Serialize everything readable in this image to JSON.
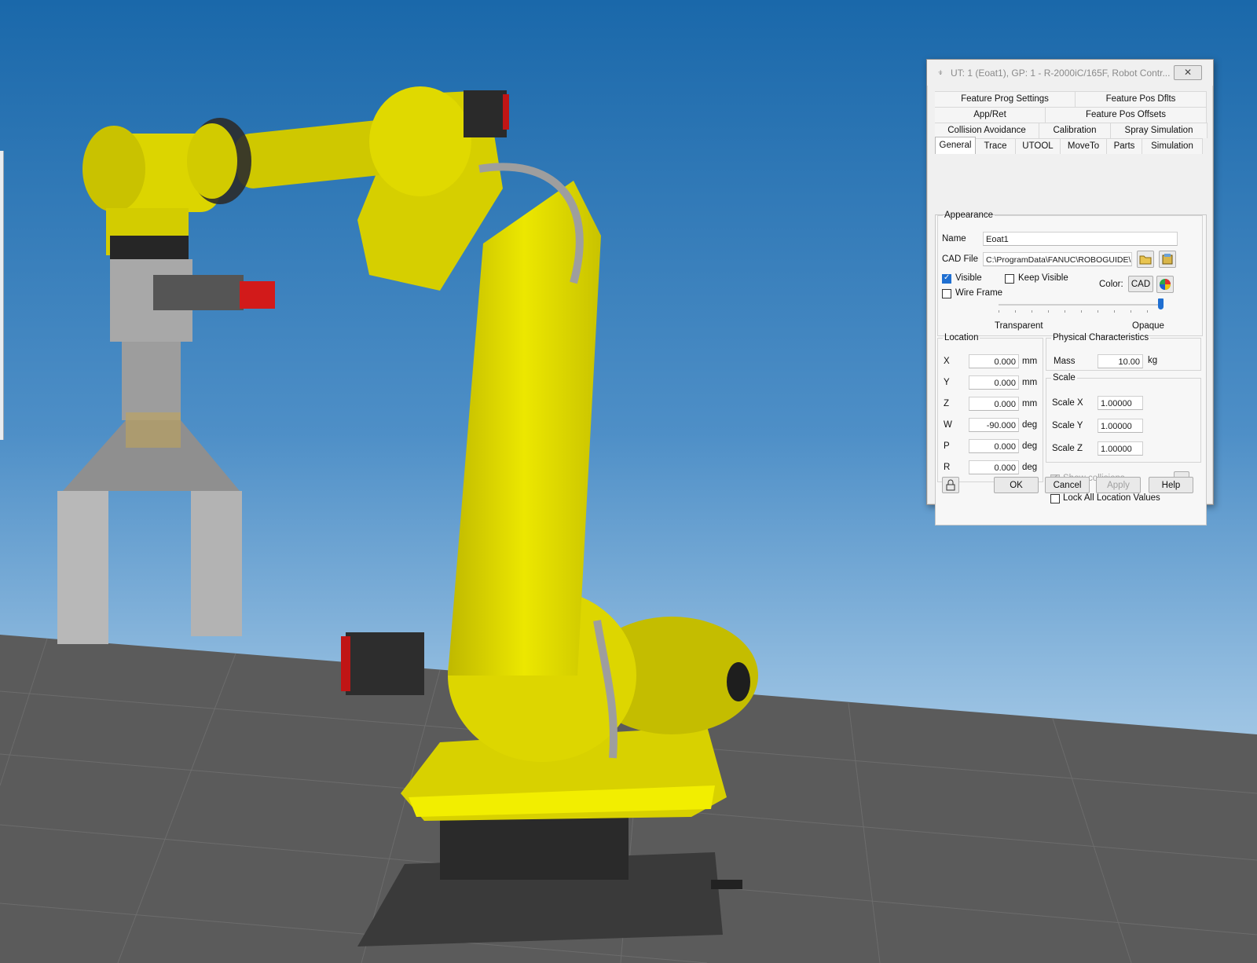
{
  "dialog": {
    "title": "UT: 1 (Eoat1), GP: 1 - R-2000iC/165F, Robot Contr...",
    "close_label": "✕",
    "tabs_row1": [
      "Feature Prog Settings",
      "Feature Pos Dflts"
    ],
    "tabs_row2": [
      "App/Ret",
      "Feature Pos Offsets"
    ],
    "tabs_row3": [
      "Collision Avoidance",
      "Calibration",
      "Spray Simulation"
    ],
    "tabs_row4": [
      "General",
      "Trace",
      "UTOOL",
      "MoveTo",
      "Parts",
      "Simulation"
    ],
    "active_tab": "General",
    "appearance": {
      "legend": "Appearance",
      "name_label": "Name",
      "name_value": "Eoat1",
      "cad_label": "CAD File",
      "cad_value": "C:\\ProgramData\\FANUC\\ROBOGUIDE\\",
      "visible_label": "Visible",
      "visible_checked": true,
      "keep_visible_label": "Keep Visible",
      "keep_visible_checked": false,
      "wire_frame_label": "Wire Frame",
      "wire_frame_checked": false,
      "color_label": "Color:",
      "cad_color_button": "CAD",
      "transparent_label": "Transparent",
      "opaque_label": "Opaque",
      "opacity_level": 1.0
    },
    "location": {
      "legend": "Location",
      "rows": [
        {
          "label": "X",
          "value": "0.000",
          "unit": "mm"
        },
        {
          "label": "Y",
          "value": "0.000",
          "unit": "mm"
        },
        {
          "label": "Z",
          "value": "0.000",
          "unit": "mm"
        },
        {
          "label": "W",
          "value": "-90.000",
          "unit": "deg"
        },
        {
          "label": "P",
          "value": "0.000",
          "unit": "deg"
        },
        {
          "label": "R",
          "value": "0.000",
          "unit": "deg"
        }
      ]
    },
    "physical": {
      "legend": "Physical Characteristics",
      "mass_label": "Mass",
      "mass_value": "10.00",
      "mass_unit": "kg"
    },
    "scale": {
      "legend": "Scale",
      "rows": [
        {
          "label": "Scale X",
          "value": "1.00000"
        },
        {
          "label": "Scale Y",
          "value": "1.00000"
        },
        {
          "label": "Scale Z",
          "value": "1.00000"
        }
      ]
    },
    "show_collisions_label": "Show collisions",
    "show_collisions_checked": true,
    "show_collisions_more": "...",
    "lock_all_label": "Lock All Location Values",
    "lock_all_checked": false,
    "buttons": {
      "ok": "OK",
      "cancel": "Cancel",
      "apply": "Apply",
      "help": "Help"
    }
  },
  "colors": {
    "sky_top": "#1c6aab",
    "sky_bottom": "#b9d6ea",
    "floor": "#5a5a5a",
    "robot_yellow": "#e6e000",
    "accent_blue": "#1f6fd1"
  }
}
